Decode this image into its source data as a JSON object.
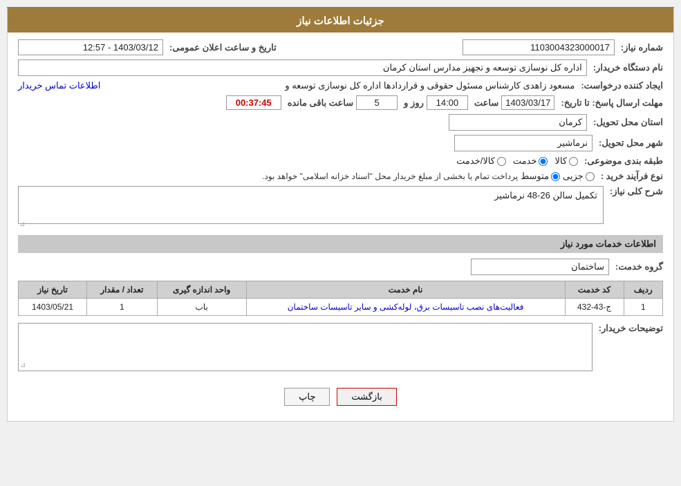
{
  "header": {
    "title": "جزئیات اطلاعات نیاز"
  },
  "fields": {
    "need_number_label": "شماره نیاز:",
    "need_number_value": "1103004323000017",
    "date_label": "تاریخ و ساعت اعلان عمومی:",
    "date_value": "1403/03/12 - 12:57",
    "buyer_org_label": "نام دستگاه خریدار:",
    "buyer_org_value": "اداره کل نوسازی  توسعه و تجهیز مدارس استان کرمان",
    "creator_label": "ایجاد کننده درخواست:",
    "creator_value": "مسعود زاهدی کارشناس مسئول حقوقی و قراردادها اداره کل نوسازی  توسعه و",
    "creator_link": "اطلاعات تماس خریدار",
    "deadline_label": "مهلت ارسال پاسخ: تا تاریخ:",
    "deadline_date": "1403/03/17",
    "deadline_time_label": "ساعت",
    "deadline_time": "14:00",
    "deadline_days_label": "روز و",
    "deadline_days": "5",
    "deadline_remaining_label": "ساعت باقی مانده",
    "deadline_remaining": "00:37:45",
    "province_label": "استان محل تحویل:",
    "province_value": "کرمان",
    "city_label": "شهر محل تحویل:",
    "city_value": "نرماشیر",
    "category_label": "طبقه بندی موضوعی:",
    "category_kala": "کالا",
    "category_khedmat": "خدمت",
    "category_kala_khedmat": "کالا/خدمت",
    "category_selected": "khedmat",
    "purchase_type_label": "نوع فرآیند خرید :",
    "purchase_jozyi": "جزیی",
    "purchase_motavasset": "متوسط",
    "purchase_note": "پرداخت تمام یا بخشی از مبلغ خریدار محل \"اسناد خزانه اسلامی\" خواهد بود.",
    "description_label": "شرح کلی نیاز:",
    "description_value": "تکمیل سالن 26-48 نرماشیر",
    "services_header": "اطلاعات خدمات مورد نیاز",
    "service_group_label": "گروه خدمت:",
    "service_group_value": "ساختمان",
    "table": {
      "col_row": "ردیف",
      "col_code": "کد خدمت",
      "col_name": "نام خدمت",
      "col_unit": "واحد اندازه گیری",
      "col_qty": "تعداد / مقدار",
      "col_date": "تاریخ نیاز",
      "rows": [
        {
          "row": "1",
          "code": "ج-43-432",
          "name": "فعالیت‌های نصب تاسیسات برق، لوله‌کشی و سایر تاسیسات ساختمان",
          "unit": "باب",
          "qty": "1",
          "date": "1403/05/21"
        }
      ]
    },
    "buyer_notes_label": "توضیحات خریدار:"
  },
  "buttons": {
    "print": "چاپ",
    "back": "بازگشت"
  }
}
